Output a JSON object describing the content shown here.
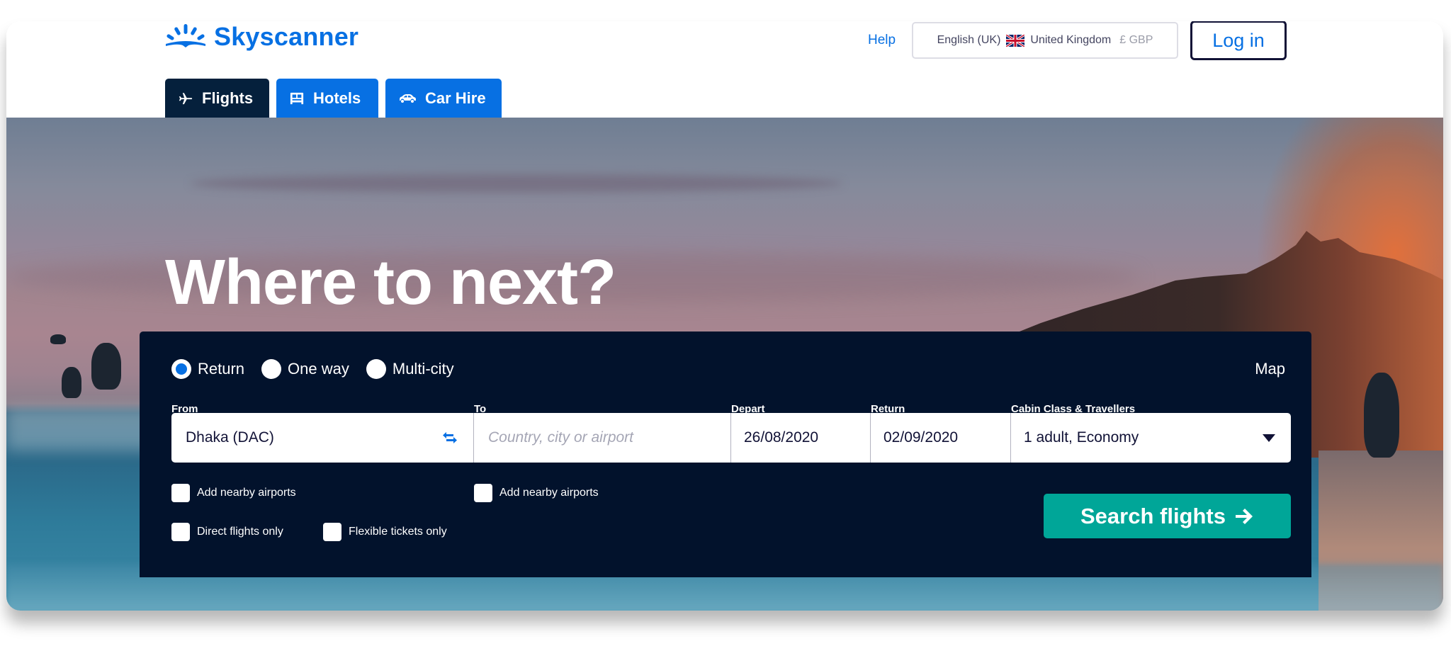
{
  "brand": {
    "name": "Skyscanner",
    "primary_color": "#0770e3",
    "dark_color": "#05203c",
    "panel_color": "#02122c",
    "cta_color": "#00a698"
  },
  "header": {
    "help_label": "Help",
    "locale": {
      "language": "English (UK)",
      "flag_icon": "uk-flag-icon",
      "country": "United Kingdom",
      "currency": "£ GBP"
    },
    "login_label": "Log in"
  },
  "tabs": [
    {
      "label": "Flights",
      "icon": "plane-icon",
      "active": true
    },
    {
      "label": "Hotels",
      "icon": "bed-icon",
      "active": false
    },
    {
      "label": "Car Hire",
      "icon": "car-icon",
      "active": false
    }
  ],
  "hero": {
    "headline": "Where to next?"
  },
  "search": {
    "trip_types": [
      {
        "label": "Return",
        "selected": true
      },
      {
        "label": "One way",
        "selected": false
      },
      {
        "label": "Multi-city",
        "selected": false
      }
    ],
    "map_label": "Map",
    "fields": {
      "from": {
        "label": "From",
        "value": "Dhaka (DAC)"
      },
      "to": {
        "label": "To",
        "value": "",
        "placeholder": "Country, city or airport"
      },
      "depart": {
        "label": "Depart",
        "value": "26/08/2020"
      },
      "return": {
        "label": "Return",
        "value": "02/09/2020"
      },
      "cabin": {
        "label": "Cabin Class & Travellers",
        "value": "1 adult, Economy"
      }
    },
    "options": {
      "nearby_from": {
        "label": "Add nearby airports",
        "checked": false
      },
      "nearby_to": {
        "label": "Add nearby airports",
        "checked": false
      },
      "direct": {
        "label": "Direct flights only",
        "checked": false
      },
      "flexible": {
        "label": "Flexible tickets only",
        "checked": false
      }
    },
    "submit_label": "Search flights",
    "submit_icon": "arrow-right-icon"
  }
}
